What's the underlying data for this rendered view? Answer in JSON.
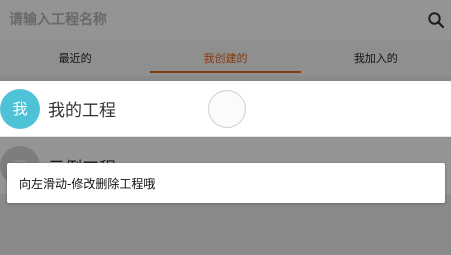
{
  "search": {
    "placeholder": "请输入工程名称"
  },
  "tabs": [
    {
      "label": "最近的",
      "active": false
    },
    {
      "label": "我创建的",
      "active": true
    },
    {
      "label": "我加入的",
      "active": false
    }
  ],
  "projects": [
    {
      "avatar_char": "我",
      "name": "我的工程",
      "avatar_color": "#4ec3d8"
    },
    {
      "avatar_char": "示",
      "name": "示例工程",
      "avatar_color": "#d8d8d8"
    }
  ],
  "guide": {
    "tip": "向左滑动-修改删除工程哦"
  },
  "colors": {
    "accent": "#e2641f",
    "overlay": "rgba(0,0,0,0.42)"
  }
}
